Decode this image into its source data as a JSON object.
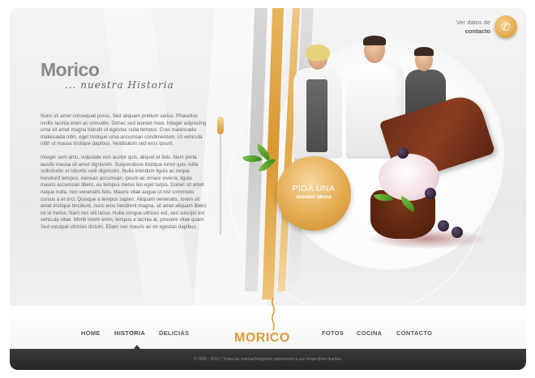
{
  "header": {
    "contact_line1": "Ver datos de",
    "contact_line2": "contacto",
    "phone_icon": "phone-icon"
  },
  "page": {
    "title": "Morico",
    "subtitle": "... nuestra Historia"
  },
  "content": {
    "paragraph1": "Nunc sit amet consequat purus. Sed aliquam pretium varius. Phasellus mollis lacinia enim ac convallis. Donec sed laoreet risus. Integer adipiscing urna sit amet magna blandit ut egestas nulla tempus. Cras malesuada malesuada nibh, eget tristique urna accumsan condimentum. Ut vehicula nibh ut massa tristique dapibus. Vestibulum sed eros ipsum.",
    "paragraph2": "Integer sem arcu, vulputate non auctor quis, aliquet et felis. Nam porta iaculis massa sit amet dignissim. Suspendisse tristique tortor quis nulla sollicitudin et lobortis velit dignissim. Nulla interdum ligula ac neque hendrerit tempus. Aenean accumsan, ipsum ac ornare viverra, ligula mauris accumsan libero, eu tempus metus leo eget turpis. Donec sit amet neque nulla, non venenatis felis. Mauris vitae augue ut nisl commodo cursus a et orci. Quisque a tempus sapien. Aliquam venenatis, lorem sit amet tristique tincidunt, nunc eros hendrerit magna, sit amet aliquam libero mi id metus. Nam nec elit lacus. Nulla congue ultrices est, sed suscipit est vehicula vitae. Morbi lorem enim, tempus a lacinia at, posuere vitae quam. Sed volutpat ultricies dictum. Etiam nec mauris ac mi egestas dapibus."
  },
  "cta": {
    "line1": "PIDA UNA",
    "line2": "reunion ahora"
  },
  "nav": {
    "items": [
      {
        "label": "HOME"
      },
      {
        "label": "HISTORIA",
        "active": true
      },
      {
        "label": "DELICIAS"
      },
      {
        "label": "FOTOS"
      },
      {
        "label": "COCINA"
      },
      {
        "label": "CONTACTO"
      }
    ]
  },
  "logo": {
    "text": "MORICO"
  },
  "footer": {
    "text": "© 2006 - 2012 | Todas las marcas/imágenes pertenecen a sus respectivos dueños."
  },
  "colors": {
    "accent_gold": "#d99a34",
    "footer_bg": "#2e2e2e",
    "text_grey": "#666666"
  }
}
